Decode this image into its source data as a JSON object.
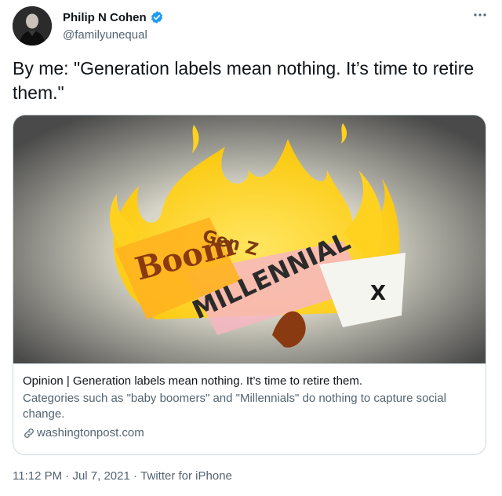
{
  "author": {
    "name": "Philip N Cohen",
    "handle": "@familyunequal",
    "verified": true
  },
  "icons": {
    "verified": "verified-badge-icon",
    "more": "more-horizontal-icon",
    "link": "link-icon"
  },
  "tweet": {
    "text": "By me: \"Generation labels mean nothing. It’s time to retire them.\""
  },
  "card": {
    "image_words": [
      "MILLENNIAL",
      "Gen Z",
      "X",
      "Boom"
    ],
    "title": "Opinion | Generation labels mean nothing. It’s time to retire them.",
    "description": "Categories such as \"baby boomers\" and \"Millennials\" do nothing to capture social change.",
    "domain": "washingtonpost.com"
  },
  "meta": {
    "time": "11:12 PM",
    "separator": " · ",
    "date": "Jul 7, 2021",
    "source": "Twitter for iPhone"
  },
  "colors": {
    "text": "#0f1419",
    "secondary": "#536471",
    "border": "#cfd9de",
    "verified": "#1d9bf0",
    "flame": "#ffd21f"
  }
}
